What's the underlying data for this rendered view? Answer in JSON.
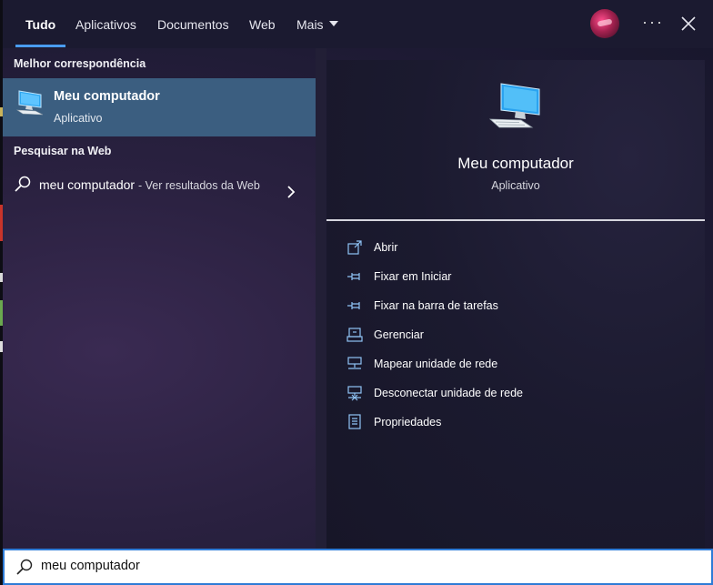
{
  "tabs": [
    {
      "label": "Tudo",
      "active": true
    },
    {
      "label": "Aplicativos"
    },
    {
      "label": "Documentos"
    },
    {
      "label": "Web"
    },
    {
      "label": "Mais"
    }
  ],
  "topbar": {
    "more_icon": "ellipsis-icon",
    "close_icon": "close-icon"
  },
  "best_match": {
    "heading": "Melhor correspondência",
    "name": "Meu computador",
    "type": "Aplicativo",
    "icon": "computer-icon"
  },
  "web_search": {
    "heading": "Pesquisar na Web",
    "query": "meu computador",
    "hint": "- Ver resultados da Web"
  },
  "details": {
    "title": "Meu computador",
    "subtitle": "Aplicativo",
    "actions": [
      {
        "label": "Abrir",
        "icon": "open-icon"
      },
      {
        "label": "Fixar em Iniciar",
        "icon": "pin-icon"
      },
      {
        "label": "Fixar na barra de tarefas",
        "icon": "pin-icon"
      },
      {
        "label": "Gerenciar",
        "icon": "manage-icon"
      },
      {
        "label": "Mapear unidade de rede",
        "icon": "network-drive-icon"
      },
      {
        "label": "Desconectar unidade de rede",
        "icon": "disconnect-drive-icon"
      },
      {
        "label": "Propriedades",
        "icon": "properties-icon"
      }
    ]
  },
  "search": {
    "value": "meu computador"
  },
  "colors": {
    "accent": "#4a9cf0",
    "selection": "#3b5e80",
    "search_border": "#2e7bd6"
  }
}
